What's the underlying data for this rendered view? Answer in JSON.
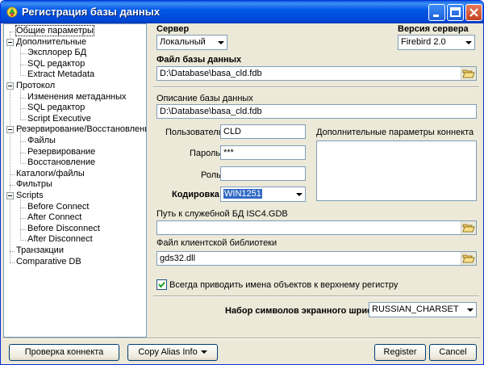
{
  "window": {
    "title": "Регистрация базы данных"
  },
  "tree": {
    "items": [
      {
        "label": "Общие параметры",
        "level": 0,
        "selected": true
      },
      {
        "label": "Дополнительные",
        "level": 0,
        "expandable": true
      },
      {
        "label": "Эксплорер БД",
        "level": 1
      },
      {
        "label": "SQL редактор",
        "level": 1
      },
      {
        "label": "Extract Metadata",
        "level": 1
      },
      {
        "label": "Протокол",
        "level": 0,
        "expandable": true
      },
      {
        "label": "Изменения метаданных",
        "level": 1
      },
      {
        "label": "SQL редактор",
        "level": 1
      },
      {
        "label": "Script Executive",
        "level": 1
      },
      {
        "label": "Резервирование/Восстановление",
        "level": 0,
        "expandable": true
      },
      {
        "label": "Файлы",
        "level": 1
      },
      {
        "label": "Резервирование",
        "level": 1
      },
      {
        "label": "Восстановление",
        "level": 1
      },
      {
        "label": "Каталоги/файлы",
        "level": 0
      },
      {
        "label": "Фильтры",
        "level": 0
      },
      {
        "label": "Scripts",
        "level": 0,
        "expandable": true
      },
      {
        "label": "Before Connect",
        "level": 1
      },
      {
        "label": "After Connect",
        "level": 1
      },
      {
        "label": "Before Disconnect",
        "level": 1
      },
      {
        "label": "After Disconnect",
        "level": 1
      },
      {
        "label": "Транзакции",
        "level": 0
      },
      {
        "label": "Comparative DB",
        "level": 0
      }
    ]
  },
  "form": {
    "server_label": "Сервер",
    "server_value": "Локальный",
    "server_version_label": "Версия сервера",
    "server_version_value": "Firebird 2.0",
    "db_file_label": "Файл базы данных",
    "db_file_value": "D:\\Database\\basa_cld.fdb",
    "db_description_label": "Описание базы данных",
    "db_description_value": "D:\\Database\\basa_cld.fdb",
    "user_label": "Пользователь",
    "user_value": "CLD",
    "password_label": "Пароль",
    "password_value": "***",
    "role_label": "Роль",
    "role_value": "",
    "encoding_label": "Кодировка",
    "encoding_value": "WIN1251",
    "extra_params_label": "Дополнительные параметры коннекта",
    "isc4_path_label": "Путь к служебной БД ISC4.GDB",
    "isc4_path_value": "",
    "client_lib_label": "Файл клиентской библиотеки",
    "client_lib_value": "gds32.dll",
    "uppercase_label": "Всегда приводить имена объектов к верхнему регистру",
    "uppercase_checked": true,
    "charset_label": "Набор символов экранного шрифта",
    "charset_value": "RUSSIAN_CHARSET"
  },
  "buttons": {
    "check_connect": "Проверка коннекта",
    "copy_alias": "Copy Alias Info",
    "register": "Register",
    "cancel": "Cancel"
  }
}
